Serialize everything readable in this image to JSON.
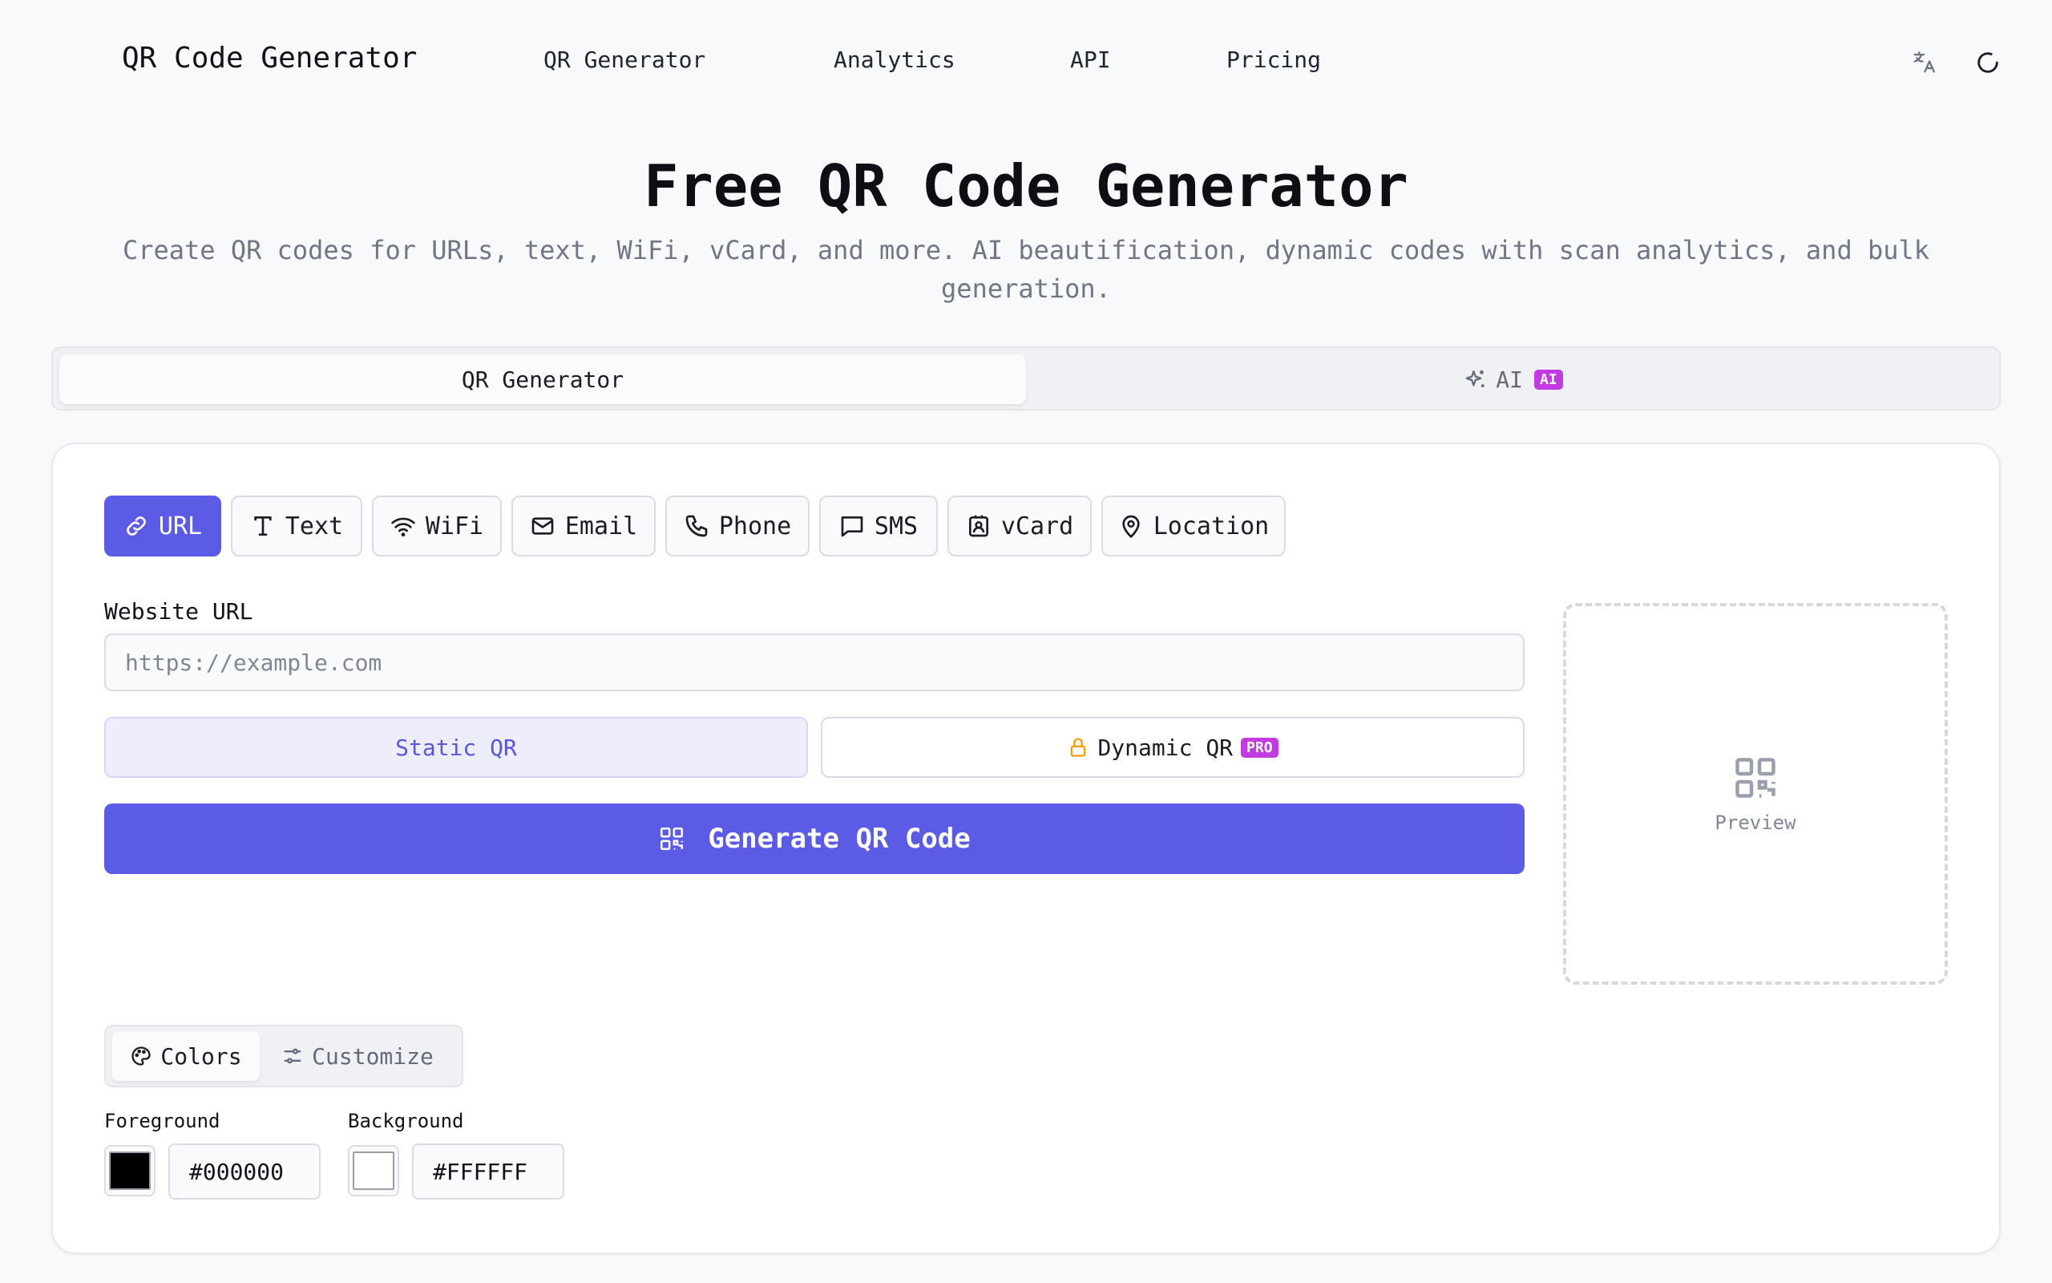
{
  "header": {
    "logo": "QR Code Generator",
    "nav": [
      "QR Generator",
      "Analytics",
      "API",
      "Pricing"
    ],
    "icons": [
      "translate-icon",
      "loading-spinner-icon"
    ]
  },
  "hero": {
    "title": "Free QR Code Generator",
    "subtitle": "Create QR codes for URLs, text, WiFi, vCard, and more. AI beautification, dynamic codes with scan analytics, and bulk generation."
  },
  "mode_tabs": {
    "generator": "QR Generator",
    "ai": "AI",
    "ai_badge": "AI"
  },
  "type_tabs": [
    {
      "label": "URL",
      "icon": "link-icon",
      "active": true
    },
    {
      "label": "Text",
      "icon": "text-icon",
      "active": false
    },
    {
      "label": "WiFi",
      "icon": "wifi-icon",
      "active": false
    },
    {
      "label": "Email",
      "icon": "mail-icon",
      "active": false
    },
    {
      "label": "Phone",
      "icon": "phone-icon",
      "active": false
    },
    {
      "label": "SMS",
      "icon": "message-icon",
      "active": false
    },
    {
      "label": "vCard",
      "icon": "contact-icon",
      "active": false
    },
    {
      "label": "Location",
      "icon": "map-pin-icon",
      "active": false
    }
  ],
  "form": {
    "url_label": "Website URL",
    "url_placeholder": "https://example.com",
    "url_value": "",
    "static_label": "Static QR",
    "dynamic_label": "Dynamic QR",
    "pro_badge": "PRO",
    "generate_label": "Generate QR Code"
  },
  "preview": {
    "label": "Preview"
  },
  "options": {
    "colors_tab": "Colors",
    "customize_tab": "Customize",
    "foreground_label": "Foreground",
    "foreground_value": "#000000",
    "background_label": "Background",
    "background_value": "#FFFFFF"
  },
  "theme": {
    "accent": "#5b5be6",
    "badge": "#c13be0",
    "lock": "#f0a000"
  }
}
